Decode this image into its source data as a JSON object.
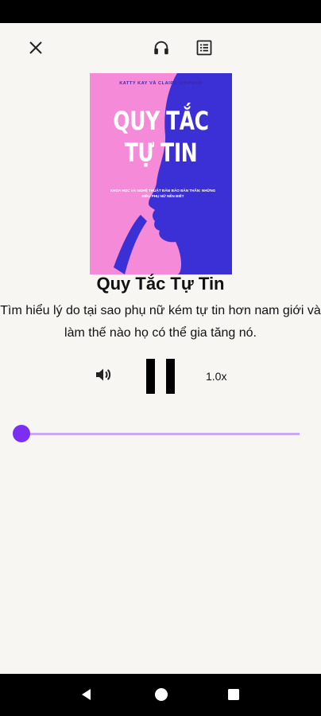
{
  "player": {
    "book": {
      "title": "Quy Tắc Tự Tin",
      "description": "Tìm hiểu lý do tại sao phụ nữ kém tự tin hơn nam giới và làm thế nào họ có thể gia tăng nó."
    },
    "cover": {
      "author": "KATTY KAY VÀ CLAIRE SHIPMAN",
      "title": "QUY TẮC TỰ TIN",
      "subtitle": "KHOA HỌC VÀ NGHỆ THUẬT ĐẢM BẢO BẢN THÂN: NHỮNG ĐIỀU PHỤ NỮ NÊN BIẾT",
      "background_color": "#f58ad8",
      "silhouette_color": "#3b2fd6"
    },
    "speed_label": "1.0x",
    "progress_fraction": 0.0,
    "accent_color": "#7b2ff2",
    "track_color": "#c8a8f2"
  },
  "icons": {
    "close": "close-icon",
    "headphones": "headphones-icon",
    "chapters": "list-icon",
    "volume": "volume-icon",
    "pause": "pause-icon"
  }
}
